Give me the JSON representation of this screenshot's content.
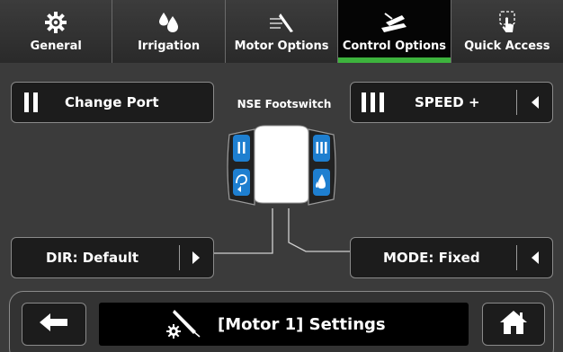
{
  "tabs": [
    {
      "label": "General",
      "icon": "gear-icon"
    },
    {
      "label": "Irrigation",
      "icon": "water-drops-icon"
    },
    {
      "label": "Motor Options",
      "icon": "handpiece-icon"
    },
    {
      "label": "Control Options",
      "icon": "footswitch-icon",
      "active": true
    },
    {
      "label": "Quick Access",
      "icon": "touch-icon"
    }
  ],
  "buttons": {
    "change_port": "Change Port",
    "speed_plus": "SPEED +",
    "dir_default": "DIR: Default",
    "mode_fixed": "MODE: Fixed"
  },
  "footswitch": {
    "title": "NSE Footswitch",
    "left_top": "II",
    "right_top": "III"
  },
  "bottom": {
    "title": "[Motor 1] Settings"
  },
  "colors": {
    "active_tab_indicator": "#3db33d",
    "footswitch_key": "#1e7fd0",
    "background": "#3b3b3b"
  }
}
